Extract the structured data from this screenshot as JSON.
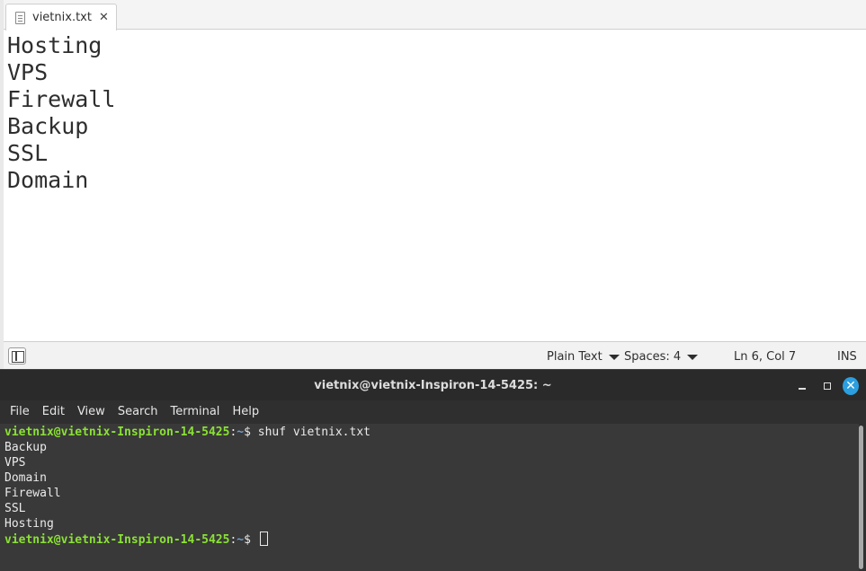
{
  "editor": {
    "tab_label": "vietnix.txt",
    "tab_close": "✕",
    "lines": [
      "Hosting",
      "VPS",
      "Firewall",
      "Backup",
      "SSL",
      "Domain"
    ],
    "status": {
      "language": "Plain Text",
      "spaces": "Spaces: 4",
      "position": "Ln 6, Col 7",
      "mode": "INS"
    }
  },
  "terminal": {
    "title": "vietnix@vietnix-Inspiron-14-5425: ~",
    "window_buttons": {
      "close": "✕"
    },
    "menu": [
      "File",
      "Edit",
      "View",
      "Search",
      "Terminal",
      "Help"
    ],
    "prompt_user": "vietnix@vietnix-Inspiron-14-5425",
    "prompt_sep": ":",
    "prompt_path": "~",
    "prompt_symbol": "$ ",
    "command": "shuf vietnix.txt",
    "output": [
      "Backup",
      "VPS",
      "Domain",
      "Firewall",
      "SSL",
      "Hosting"
    ]
  },
  "colors": {
    "prompt_user": "#8ae234",
    "prompt_path": "#729fcf",
    "close_button": "#2b9fe0"
  }
}
